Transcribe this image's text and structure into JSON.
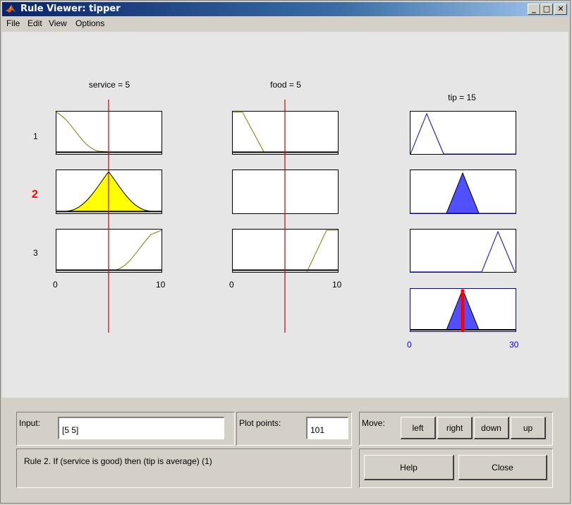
{
  "window": {
    "title": "Rule Viewer: tipper"
  },
  "titlebar_buttons": {
    "minimize": "_",
    "maximize": "□",
    "close": "✕"
  },
  "menu": [
    "File",
    "Edit",
    "View",
    "Options"
  ],
  "inputs": [
    {
      "name": "service",
      "label": "service = 5",
      "value": 5,
      "range": [
        0,
        10
      ],
      "tick_min": "0",
      "tick_max": "10"
    },
    {
      "name": "food",
      "label": "food = 5",
      "value": 5,
      "range": [
        0,
        10
      ],
      "tick_min": "0",
      "tick_max": "10"
    }
  ],
  "output": {
    "name": "tip",
    "label": "tip = 15",
    "value": 15,
    "range": [
      0,
      30
    ],
    "tick_min": "0",
    "tick_max": "30"
  },
  "rules": [
    {
      "number": "1",
      "active": false
    },
    {
      "number": "2",
      "active": true
    },
    {
      "number": "3",
      "active": false
    }
  ],
  "colors": {
    "rule_line": "#cc0000",
    "mf_input": "#808000",
    "input_fill": "#ffff00",
    "output_fill": "#5050ff",
    "output_line": "#0000cc",
    "aggregate_line": "#ff0000"
  },
  "controls": {
    "input_label": "Input:",
    "input_value": "[5 5]",
    "plot_points_label": "Plot points:",
    "plot_points_value": "101",
    "move_label": "Move:",
    "move_buttons": [
      "left",
      "right",
      "down",
      "up"
    ],
    "help_label": "Help",
    "close_label": "Close",
    "status_text": "Rule 2. If (service is good) then (tip is average) (1)"
  }
}
